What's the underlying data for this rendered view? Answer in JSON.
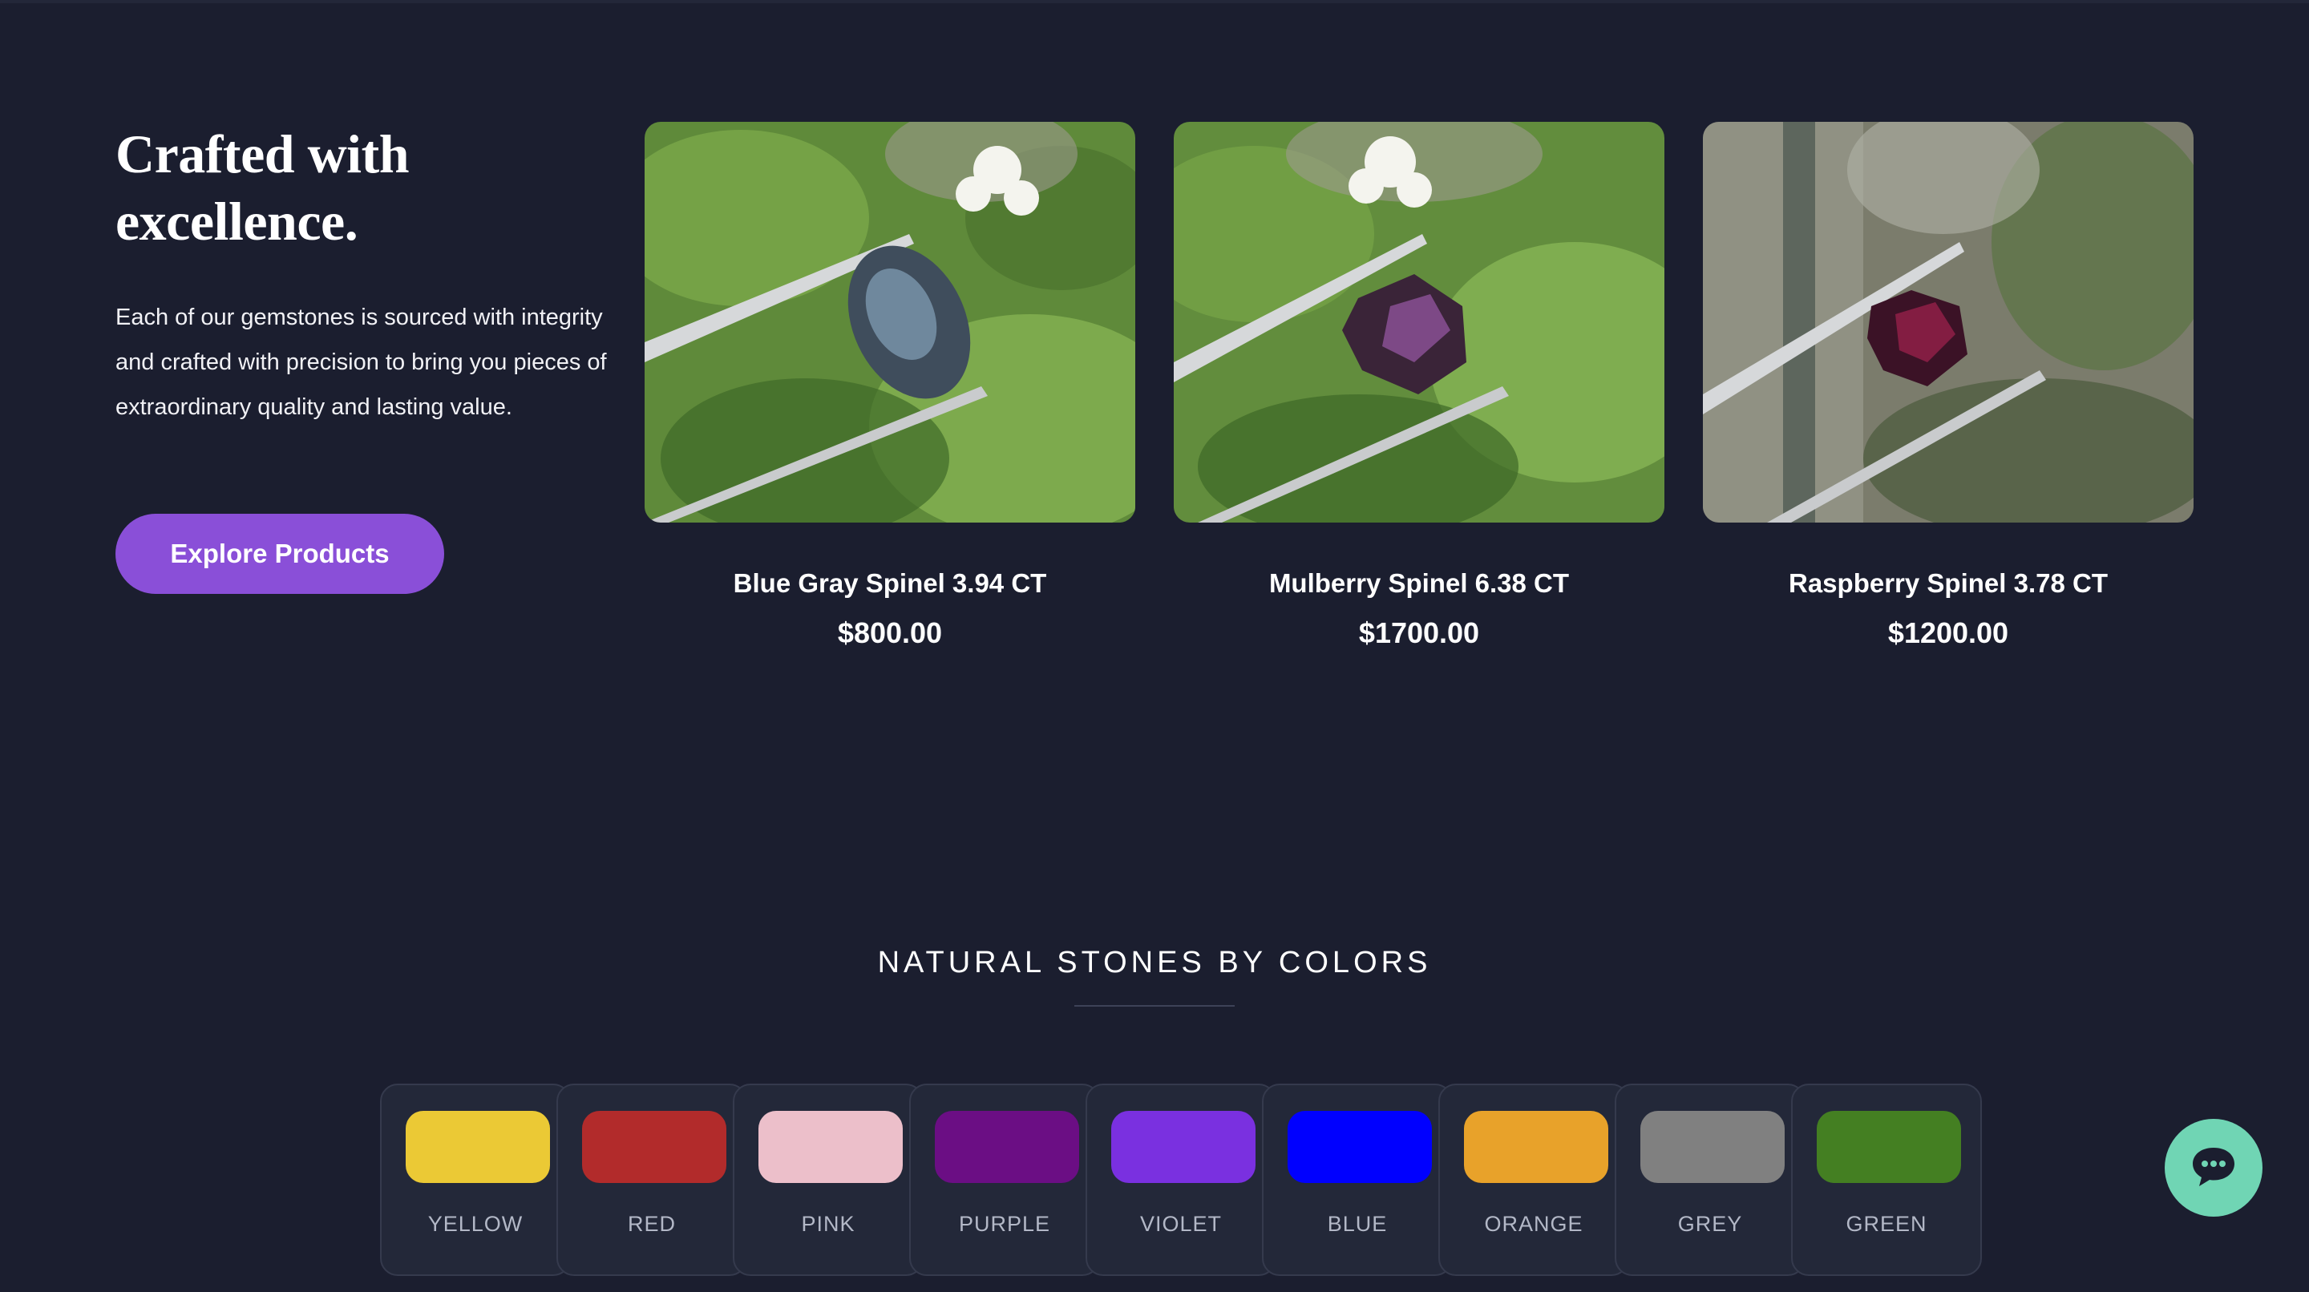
{
  "hero": {
    "title": "Crafted with excellence.",
    "description": "Each of our gemstones is sourced with integrity and crafted with precision to bring you pieces of extraordinary quality and lasting value.",
    "cta_label": "Explore Products"
  },
  "products": [
    {
      "name": "Blue Gray Spinel 3.94 CT",
      "price": "$800.00",
      "gem_color": "#3f4d5c",
      "background": "green-foliage"
    },
    {
      "name": "Mulberry Spinel 6.38 CT",
      "price": "$1700.00",
      "gem_color": "#5a2a55",
      "background": "green-foliage"
    },
    {
      "name": "Raspberry Spinel 3.78 CT",
      "price": "$1200.00",
      "gem_color": "#5b1838",
      "background": "grey-foliage"
    }
  ],
  "colors_section": {
    "title": "NATURAL STONES BY COLORS",
    "swatches": [
      {
        "label": "YELLOW",
        "color": "#ebc935"
      },
      {
        "label": "RED",
        "color": "#b22b2b"
      },
      {
        "label": "PINK",
        "color": "#ecbfca"
      },
      {
        "label": "PURPLE",
        "color": "#6b0e84"
      },
      {
        "label": "VIOLET",
        "color": "#7a30e0"
      },
      {
        "label": "BLUE",
        "color": "#0000ff"
      },
      {
        "label": "ORANGE",
        "color": "#e8a22a"
      },
      {
        "label": "GREY",
        "color": "#808080"
      },
      {
        "label": "GREEN",
        "color": "#447f22"
      }
    ]
  },
  "chat": {
    "icon": "chat-bubble-icon"
  },
  "theme": {
    "background": "#1b1e2f",
    "accent": "#8a4fd8",
    "chat_accent": "#70d5b4",
    "card": "#232839"
  }
}
